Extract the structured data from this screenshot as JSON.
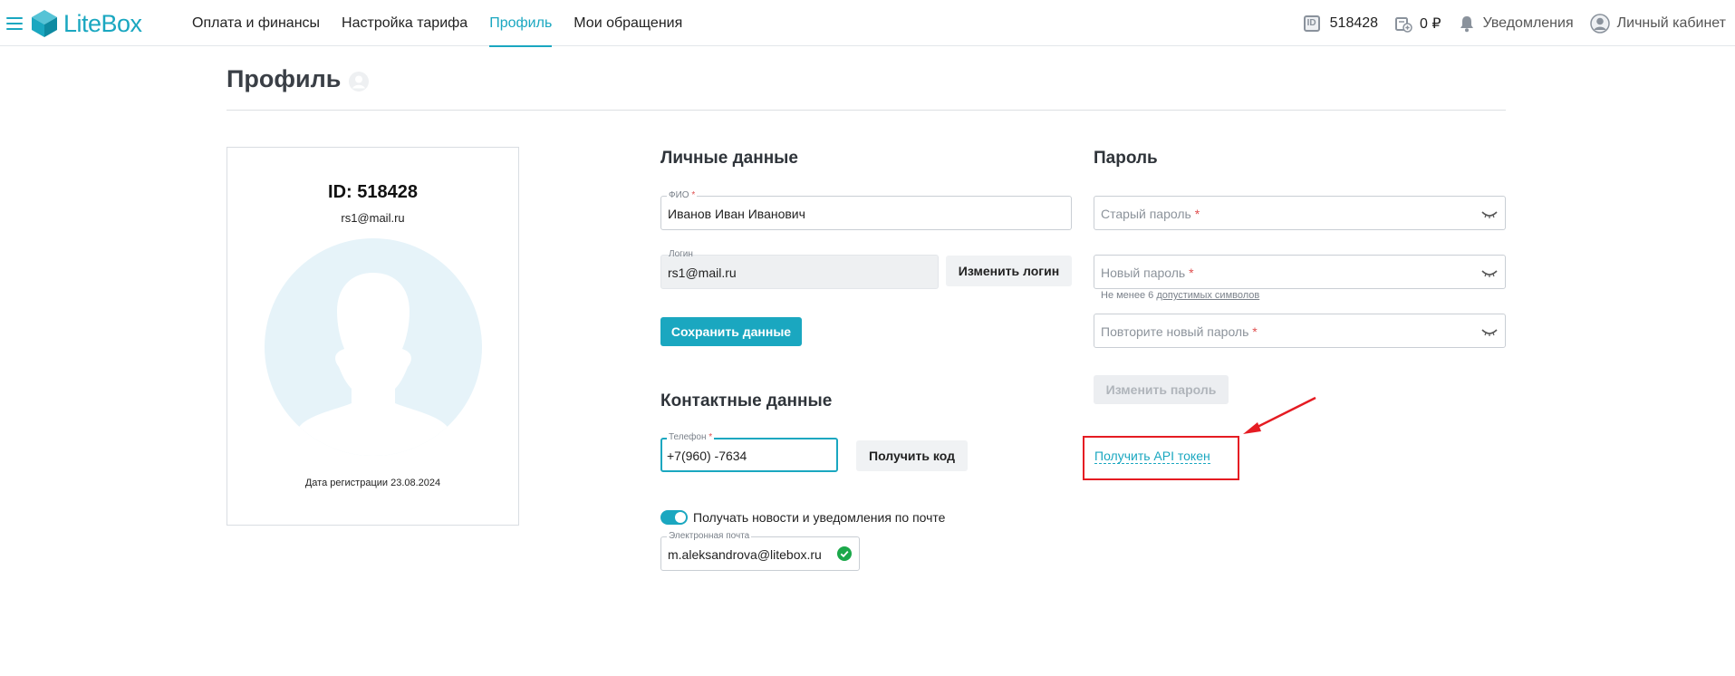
{
  "nav": {
    "brand": "LiteBox",
    "links": [
      "Оплата и финансы",
      "Настройка тарифа",
      "Профиль",
      "Мои обращения"
    ],
    "active_index": 2,
    "account_id": "518428",
    "balance": "0 ₽",
    "notifications_label": "Уведомления",
    "cabinet_label": "Личный кабинет",
    "id_badge": "ID"
  },
  "page": {
    "title": "Профиль"
  },
  "card": {
    "id_line": "ID: 518428",
    "email": "rs1@mail.ru",
    "registration": "Дата регистрации 23.08.2024"
  },
  "personal": {
    "heading": "Личные данные",
    "fio_label": "ФИО",
    "fio_value": "Иванов Иван Иванович",
    "login_label": "Логин",
    "login_value": "rs1@mail.ru",
    "change_login": "Изменить логин",
    "save": "Сохранить данные"
  },
  "contacts": {
    "heading": "Контактные данные",
    "phone_label": "Телефон",
    "phone_value": "+7(960)      -7634",
    "get_code": "Получить код",
    "news_toggle_label": "Получать новости и уведомления по почте",
    "news_toggle_on": true,
    "email_label": "Электронная почта",
    "email_value": "m.aleksandrova@litebox.ru"
  },
  "password": {
    "heading": "Пароль",
    "old_placeholder": "Старый пароль",
    "new_placeholder": "Новый пароль",
    "repeat_placeholder": "Повторите новый пароль",
    "hint_prefix": "Не менее 6 ",
    "hint_link": "допустимых символов",
    "change": "Изменить пароль",
    "api_token": "Получить API токен"
  },
  "colors": {
    "accent": "#1aa7c0",
    "annotation": "#e51c23"
  }
}
